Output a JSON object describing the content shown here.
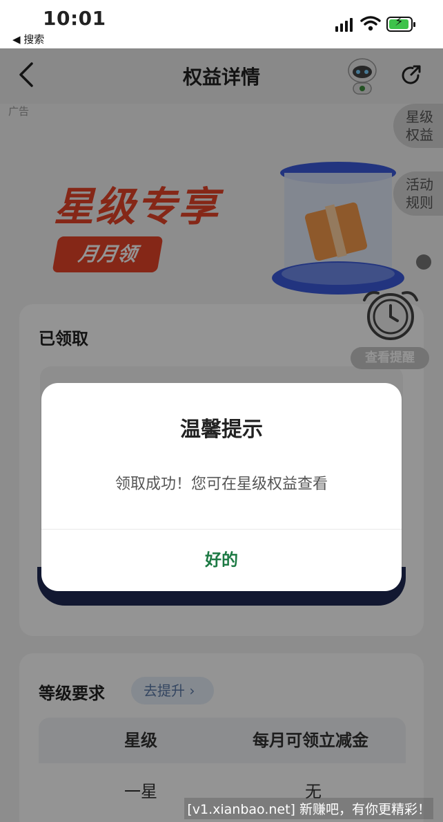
{
  "status_bar": {
    "time": "10:01",
    "back_app": "◀ 搜索"
  },
  "nav": {
    "title": "权益详情",
    "icons": [
      "back-arrow-icon",
      "robot-assistant-icon",
      "share-icon"
    ]
  },
  "page": {
    "ad_label": "广告",
    "side_buttons": [
      "星级\n权益",
      "活动\n规则"
    ],
    "banner_title": "星级专享",
    "banner_badge": "月月领",
    "timer_label": "查看提醒",
    "received_title": "已领取",
    "level": {
      "title": "等级要求",
      "upgrade_label": "去提升 ›",
      "col_star": "星级",
      "col_amount": "每月可领立减金",
      "row_star": "一星",
      "row_amount": "无"
    }
  },
  "dialog": {
    "title": "温馨提示",
    "message": "领取成功！您可在星级权益查看",
    "ok_label": "好的"
  },
  "watermark": "[v1.xianbao.net] 新赚吧，有你更精彩！",
  "colors": {
    "accent_green": "#1d7a44",
    "banner_red": "#e64429",
    "overlay": "rgba(0,0,0,0.42)"
  }
}
